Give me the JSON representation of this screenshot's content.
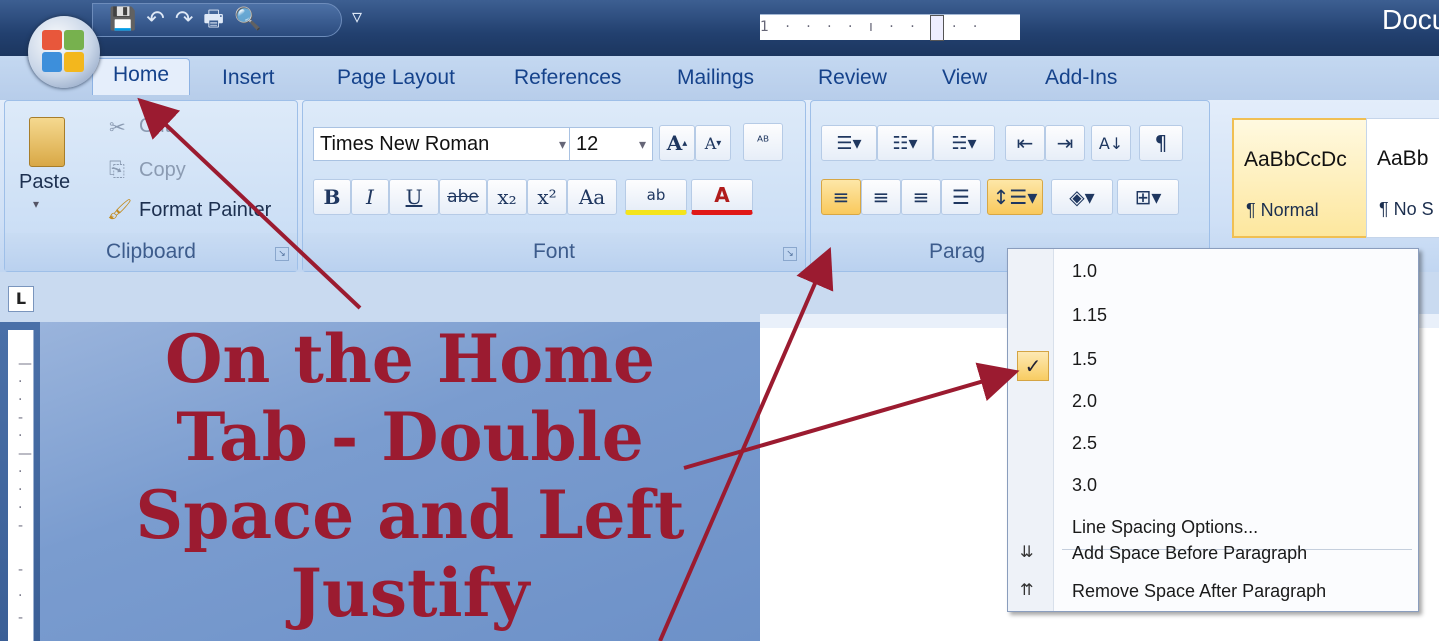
{
  "window": {
    "title": "Docu"
  },
  "tabs": [
    "Home",
    "Insert",
    "Page Layout",
    "References",
    "Mailings",
    "Review",
    "View",
    "Add-Ins"
  ],
  "clipboard": {
    "paste": "Paste",
    "cut": "Cut",
    "copy": "Copy",
    "format_painter": "Format Painter",
    "label": "Clipboard"
  },
  "font": {
    "family": "Times New Roman",
    "size": "12",
    "label": "Font",
    "bold": "B",
    "italic": "I",
    "underline": "U",
    "strike": "abe",
    "subscript": "x₂",
    "superscript": "x²",
    "case": "Aa",
    "grow": "A",
    "shrink": "A",
    "highlight": "ab",
    "color": "A"
  },
  "paragraph": {
    "label": "Parag",
    "pilcrow": "¶"
  },
  "styles": [
    {
      "sample": "AaBbCcDc",
      "name": "¶ Normal"
    },
    {
      "sample": "AaBb",
      "name": "¶ No S"
    }
  ],
  "ruler": {
    "corner": "L",
    "ticks": "1 · · · · ı · · · · ·"
  },
  "line_spacing_menu": {
    "options": [
      "1.0",
      "1.15",
      "1.5",
      "2.0",
      "2.5",
      "3.0"
    ],
    "selected": "2.0",
    "more": "Line Spacing Options...",
    "add_before": "Add Space Before Paragraph",
    "remove_after": "Remove Space After Paragraph"
  },
  "caption": [
    "On the Home",
    "Tab - Double",
    "Space and Left",
    "Justify"
  ],
  "colors": {
    "accent": "#9b1b30",
    "ribbon": "#dbe7f7",
    "highlight": "#f9c95c"
  }
}
